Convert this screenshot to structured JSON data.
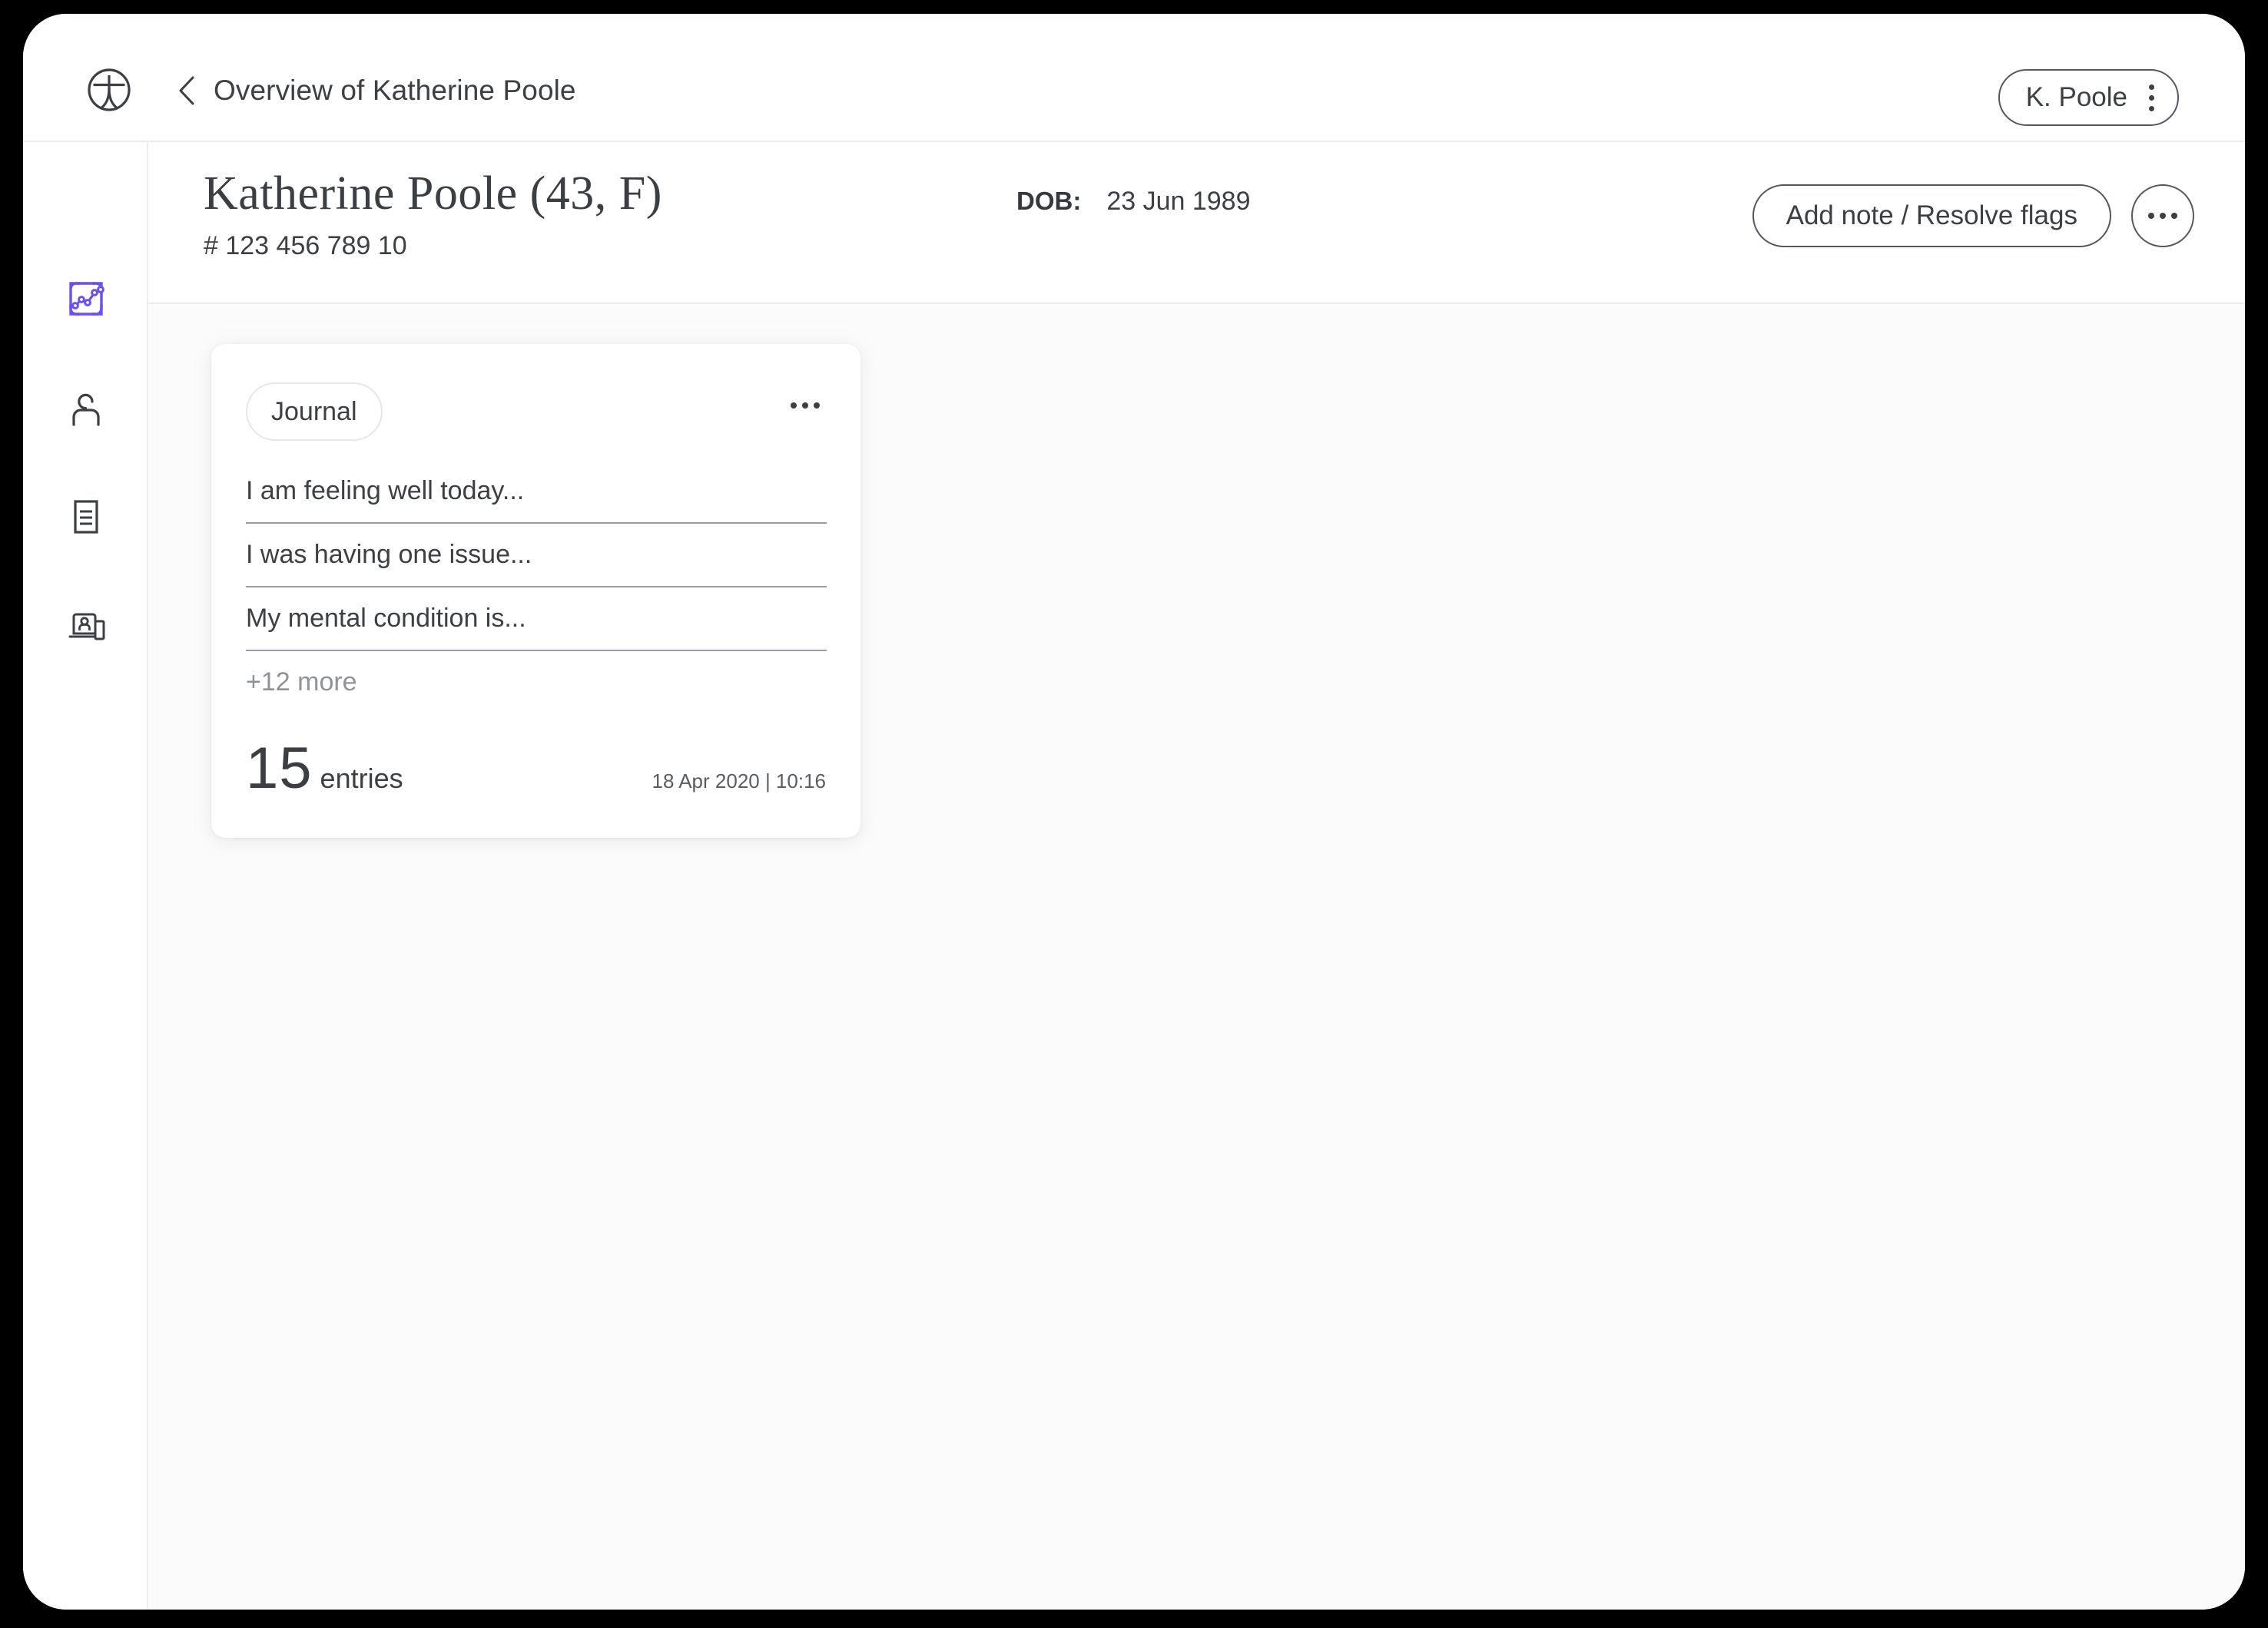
{
  "app": {
    "logo_icon": "clinic-logo-icon"
  },
  "topbar": {
    "back_icon": "chevron-left-icon",
    "breadcrumb": "Overview of Katherine Poole",
    "user_chip": {
      "label": "K. Poole",
      "menu_icon": "vertical-dots-icon"
    }
  },
  "sidebar": {
    "items": [
      {
        "name": "analytics",
        "icon": "line-chart-icon",
        "active": true
      },
      {
        "name": "profile",
        "icon": "person-icon",
        "active": false
      },
      {
        "name": "documents",
        "icon": "document-icon",
        "active": false
      },
      {
        "name": "telehealth",
        "icon": "laptop-person-icon",
        "active": false
      }
    ]
  },
  "patient": {
    "name": "Katherine Poole (43,  F)",
    "id": "# 123 456 789 10",
    "dob_label": "DOB:",
    "dob_value": "23 Jun 1989",
    "actions": {
      "add_note_label": "Add note / Resolve flags",
      "more_icon": "horizontal-dots-icon"
    }
  },
  "journal_card": {
    "tag": "Journal",
    "more_icon": "horizontal-dots-icon",
    "entries": [
      "I am feeling well today...",
      "I was having one issue...",
      "My mental condition is..."
    ],
    "more_link": "+12 more",
    "count": "15",
    "count_unit": "entries",
    "timestamp": "18 Apr 2020 | 10:16"
  },
  "colors": {
    "accent": "#6B4EFF",
    "text": "#3C3F44",
    "muted": "#8F9296",
    "divider": "#EDEDEE",
    "entry_rule": "#9A9DA2",
    "canvas": "#FBFBFB"
  }
}
